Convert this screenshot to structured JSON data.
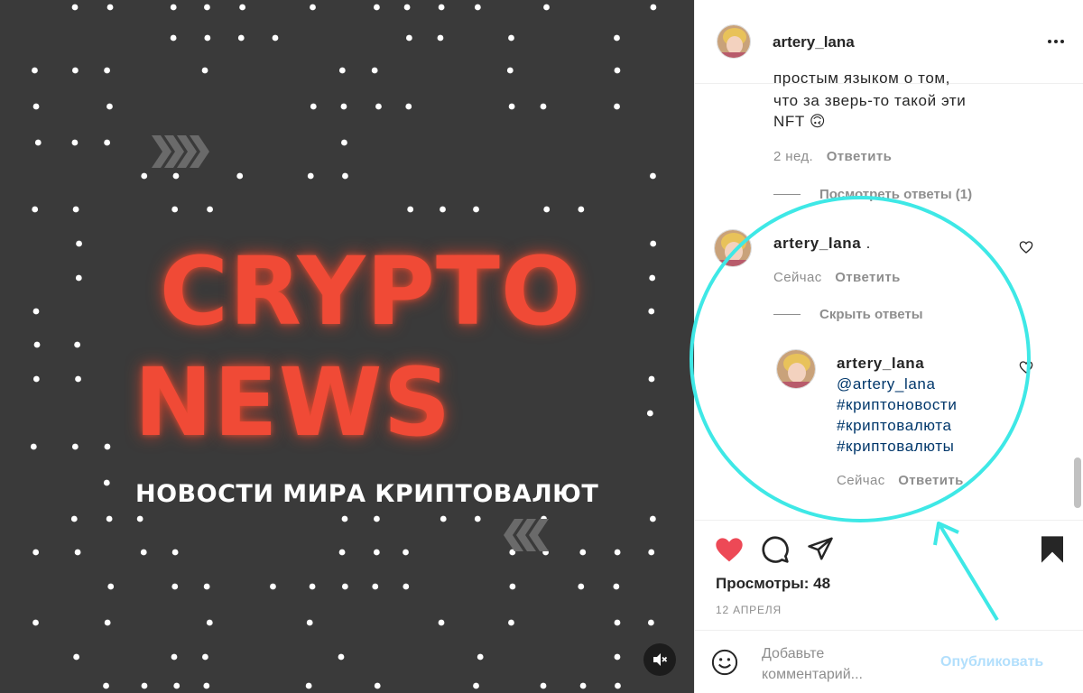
{
  "media": {
    "brand_line1": "CRYPTO",
    "brand_line2": "NEWS",
    "brand_subtitle": "НОВОСТИ МИРА КРИПТОВАЛЮТ",
    "mute_icon": "speaker-muted-icon",
    "brand_color": "#f04a36",
    "background_color": "#3a3a3a"
  },
  "header": {
    "username": "artery_lana",
    "more_icon": "more-dots-icon"
  },
  "comments": {
    "partial_text_line1": "простым языком о том,",
    "partial_text_line2": "что за зверь-то такой эти",
    "partial_text_line3": "NFT 🙃",
    "partial_time": "2 нед.",
    "partial_reply": "Ответить",
    "view_replies": "Посмотреть ответы (1)",
    "second_username": "artery_lana",
    "second_text": ".",
    "second_time": "Сейчас",
    "second_reply": "Ответить",
    "hide_replies": "Скрыть ответы",
    "reply": {
      "username": "artery_lana",
      "mention": "@artery_lana",
      "tag1": "#криптоновости",
      "tag2": "#криптовалюта",
      "tag3": "#криптовалюты",
      "time": "Сейчас",
      "reply_label": "Ответить"
    }
  },
  "actions": {
    "like_color": "#ed4956",
    "views_label": "Просмотры: 48",
    "date": "12 АПРЕЛЯ"
  },
  "composer": {
    "placeholder": "Добавьте комментарий...",
    "publish": "Опубликовать"
  },
  "annotation": {
    "color": "#3ee8e6"
  }
}
